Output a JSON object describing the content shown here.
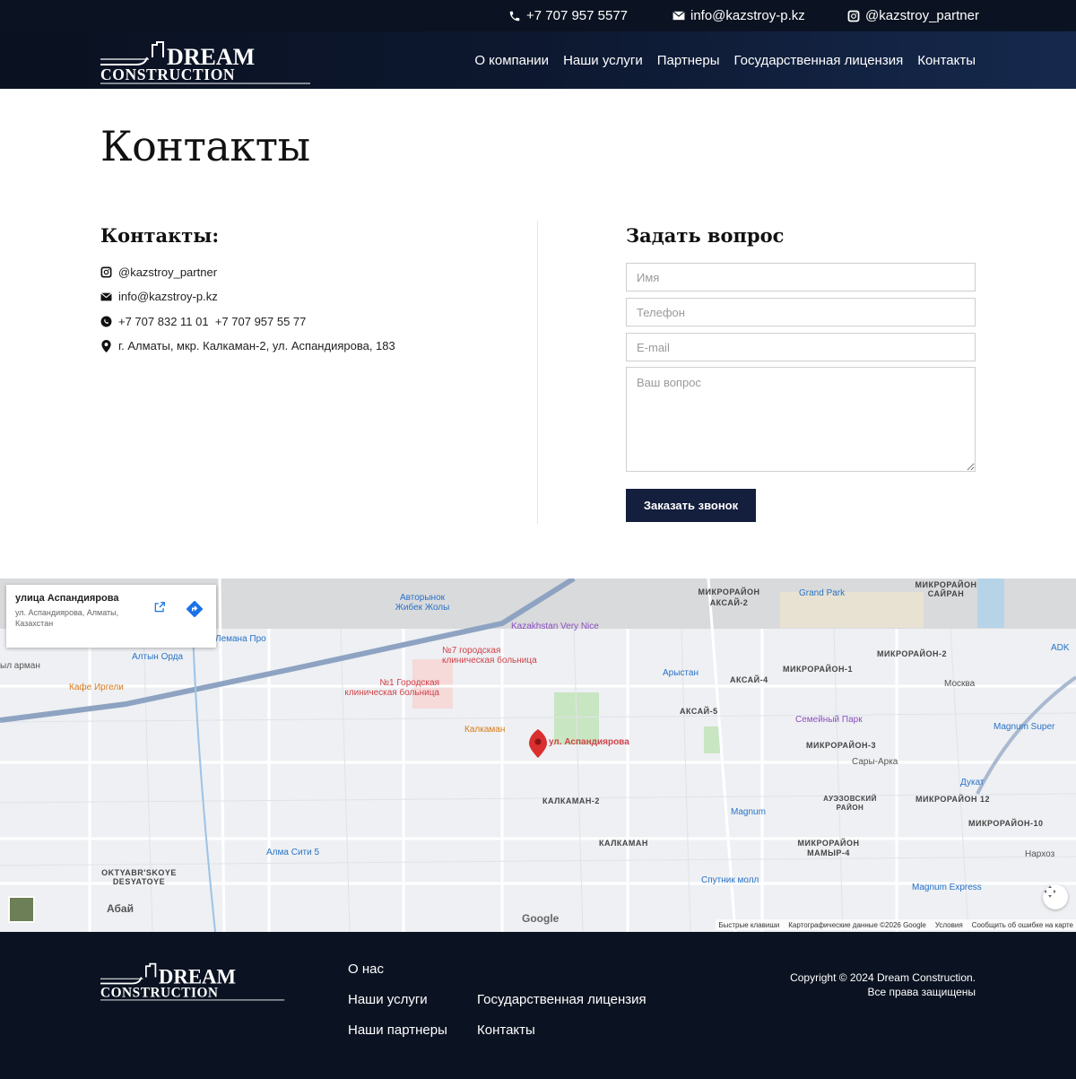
{
  "topbar": {
    "phone": "+7 707 957 5577",
    "email": "info@kazstroy-p.kz",
    "instagram": "@kazstroy_partner"
  },
  "brand": {
    "line1": "DREAM",
    "line2": "CONSTRUCTION"
  },
  "nav": {
    "items": [
      "О компании",
      "Наши услуги",
      "Партнеры",
      "Государственная лицензия",
      "Контакты"
    ]
  },
  "page": {
    "title": "Контакты"
  },
  "contacts": {
    "heading": "Контакты:",
    "instagram": "@kazstroy_partner",
    "email": "info@kazstroy-p.kz",
    "phones": "+7 707 832 11 01  +7 707 957 55 77",
    "address": "г. Алматы, мкр. Калкаман-2, ул. Аспандиярова, 183"
  },
  "form": {
    "heading": "Задать вопрос",
    "name_placeholder": "Имя",
    "phone_placeholder": "Телефон",
    "email_placeholder": "E-mail",
    "question_placeholder": "Ваш вопрос",
    "submit_label": "Заказать звонок"
  },
  "map": {
    "card_title": "улица Аспандиярова",
    "card_subtitle": "ул. Аспандиярова, Алматы, Казахстан",
    "pin_label": "ул. Аспандиярова",
    "google_label": "Google",
    "footer_links": [
      "Быстрые клавиши",
      "Картографические данные ©2026 Google",
      "Условия",
      "Сообщить об ошибке на карте"
    ],
    "labels": {
      "mkr_aksai2": "МИКРОРАЙОН АКСАЙ-2",
      "mkr_sairan": "МИКРОРАЙОН САЙРАН",
      "grand_park": "Grand Park",
      "avtorynok": "Авторынок Жибек Жолы",
      "kvn": "Kazakhstan Very Nice",
      "hosp7": "№7 городская клиническая больница",
      "hosp1": "№1 Городская клиническая больница",
      "altyn_orda": "Алтын Орда",
      "kafe": "Кафе Иргели",
      "kalkaman_cafe": "Калкаман",
      "aryistan": "Арыстан",
      "aksai4": "АКСАЙ-4",
      "aksai5": "АКСАЙ-5",
      "mkr1": "МИКРОРАЙОН-1",
      "mkr2": "МИКРОРАЙОН-2",
      "mkr3": "МИКРОРАЙОН-3",
      "moskva": "Москва",
      "semeiny": "Семейный Парк",
      "sary_arka": "Сары-Арка",
      "magnum_super": "Magnum Super",
      "dukat": "Дукат",
      "auezov": "АУЭЗОВСКИЙ РАЙОН",
      "mkr12": "МИКРОРАЙОН 12",
      "mkr10": "МИКРОРАЙОН-10",
      "kalkaman2": "КАЛКАМАН-2",
      "kalkaman": "КАЛКАМАН",
      "magnum": "Magnum",
      "mamyr4": "МИКРОРАЙОН МАМЫР-4",
      "narhoz": "Нархоз",
      "alma_siti": "Алма Сити 5",
      "sputnik": "Спутник молл",
      "magnum_express": "Magnum Express",
      "oktyabr": "OKTYABR'SKOYE DESYATOYE",
      "abai": "Абай",
      "lemana": "Лемана Про",
      "yl_arman": "ыл арман",
      "adk": "ADK"
    }
  },
  "footer": {
    "links": {
      "about": "О нас",
      "services": "Наши услуги",
      "partners": "Наши партнеры",
      "license": "Государственная лицензия",
      "contacts": "Контакты"
    },
    "copyright_line1": "Copyright © 2024 Dream Construction.",
    "copyright_line2": "Все права защищены"
  }
}
